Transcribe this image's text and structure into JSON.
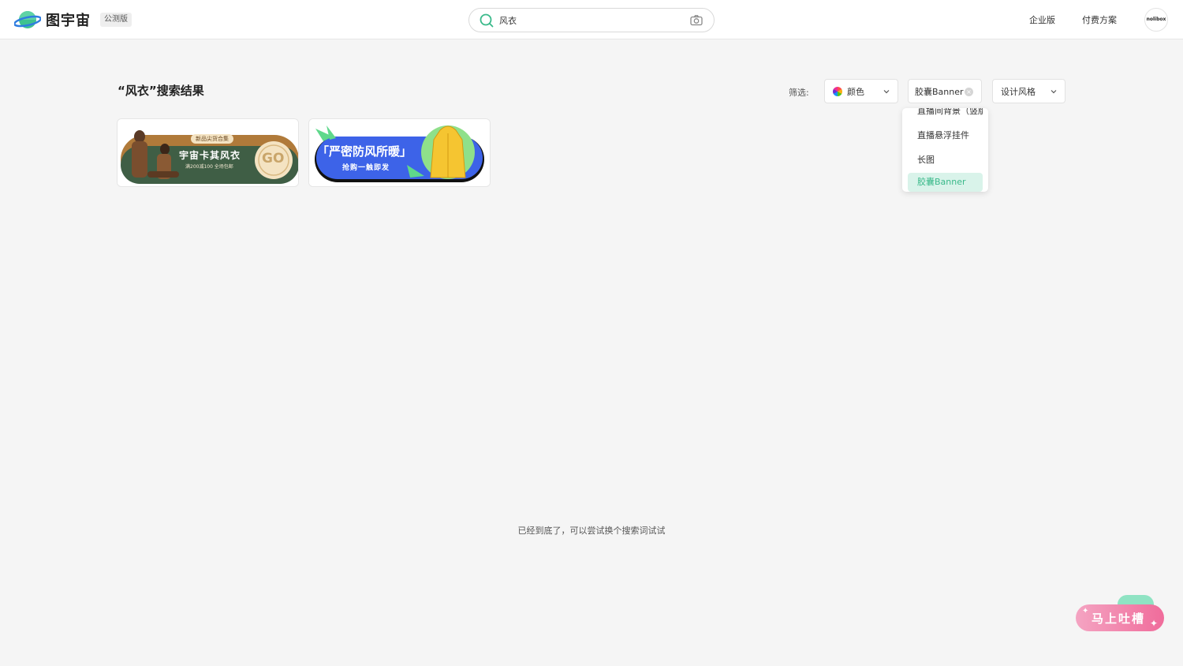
{
  "header": {
    "logo_text": "图宇宙",
    "badge": "公测版",
    "search": {
      "value": "风衣",
      "placeholder": ""
    },
    "nav": {
      "enterprise": "企业版",
      "pricing": "付费方案"
    },
    "avatar_text": "nolibox"
  },
  "results": {
    "title": "“风衣”搜索结果",
    "end_text": "已经到底了，可以尝试换个搜索词试试"
  },
  "filters": {
    "label": "筛选:",
    "color": "颜色",
    "type_selected": "胶囊Banner",
    "style": "设计风格"
  },
  "dropdown": {
    "items": [
      "直播间背景（竖版",
      "直播悬浮挂件",
      "长图",
      "胶囊Banner"
    ],
    "selected_index": 3
  },
  "cards": [
    {
      "tag": "新品尖货合集",
      "headline": "宇宙卡其风衣",
      "sub": "满200减100 全场包邮",
      "cta": "GO"
    },
    {
      "headline": "「严密防风所暖」",
      "sub": "抢购一触即发"
    }
  ],
  "feedback": {
    "label": "马上吐槽"
  },
  "colors": {
    "accent_green": "#39b98a",
    "card1_bg": "#3f5e45",
    "card2_bg": "#3d63e8",
    "feedback_pink": "#f06c9b"
  }
}
